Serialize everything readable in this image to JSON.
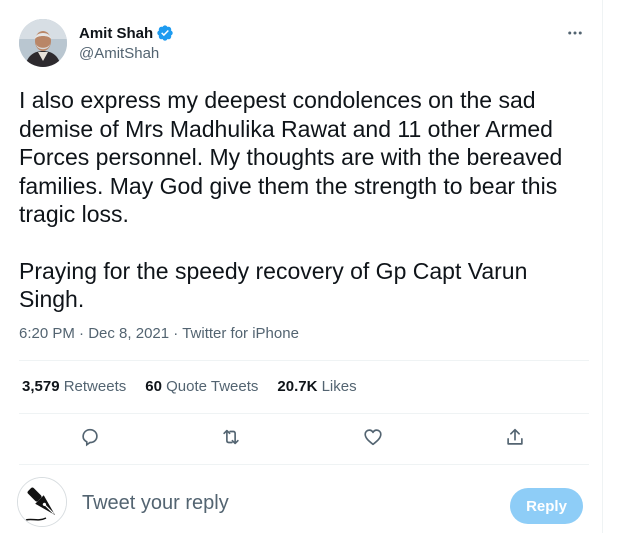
{
  "author": {
    "name": "Amit Shah",
    "handle": "@AmitShah",
    "verified": true
  },
  "tweet": {
    "paragraphs": [
      "I also express my deepest condolences on the sad demise of Mrs Madhulika Rawat and 11 other Armed Forces personnel. My thoughts are with the bereaved families. May God give them the strength to bear this tragic loss.",
      "Praying for the speedy recovery of Gp Capt Varun Singh."
    ],
    "time": "6:20 PM",
    "separator": "·",
    "date": "Dec 8, 2021",
    "source": "Twitter for iPhone"
  },
  "stats": {
    "retweets_count": "3,579",
    "retweets_label": "Retweets",
    "quotes_count": "60",
    "quotes_label": "Quote Tweets",
    "likes_count": "20.7K",
    "likes_label": "Likes"
  },
  "actions": {
    "icons": [
      "reply-icon",
      "retweet-icon",
      "like-icon",
      "share-icon"
    ]
  },
  "reply_box": {
    "placeholder": "Tweet your reply",
    "button_label": "Reply"
  },
  "colors": {
    "text": "#0f1419",
    "secondary": "#536471",
    "verified": "#1d9bf0",
    "reply_button_disabled": "#8ecdf7",
    "divider": "#eff3f4"
  }
}
